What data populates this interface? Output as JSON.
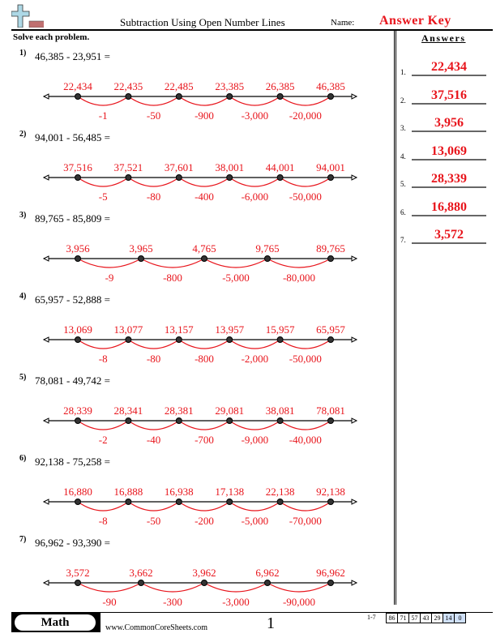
{
  "header": {
    "title": "Subtraction Using Open Number Lines",
    "name_label": "Name:",
    "name_value": "Answer Key",
    "instructions": "Solve each problem.",
    "answers_heading": "Answers"
  },
  "colors": {
    "accent_red": "#e8151c",
    "line_black": "#000000"
  },
  "problems": [
    {
      "num": "1)",
      "expr": "46,385 - 23,951 =",
      "points": [
        "22,434",
        "22,435",
        "22,485",
        "23,385",
        "26,385",
        "46,385"
      ],
      "jumps": [
        "-1",
        "-50",
        "-900",
        "-3,000",
        "-20,000"
      ]
    },
    {
      "num": "2)",
      "expr": "94,001 - 56,485 =",
      "points": [
        "37,516",
        "37,521",
        "37,601",
        "38,001",
        "44,001",
        "94,001"
      ],
      "jumps": [
        "-5",
        "-80",
        "-400",
        "-6,000",
        "-50,000"
      ]
    },
    {
      "num": "3)",
      "expr": "89,765 - 85,809 =",
      "points": [
        "3,956",
        "3,965",
        "4,765",
        "9,765",
        "89,765"
      ],
      "jumps": [
        "-9",
        "-800",
        "-5,000",
        "-80,000"
      ]
    },
    {
      "num": "4)",
      "expr": "65,957 - 52,888 =",
      "points": [
        "13,069",
        "13,077",
        "13,157",
        "13,957",
        "15,957",
        "65,957"
      ],
      "jumps": [
        "-8",
        "-80",
        "-800",
        "-2,000",
        "-50,000"
      ]
    },
    {
      "num": "5)",
      "expr": "78,081 - 49,742 =",
      "points": [
        "28,339",
        "28,341",
        "28,381",
        "29,081",
        "38,081",
        "78,081"
      ],
      "jumps": [
        "-2",
        "-40",
        "-700",
        "-9,000",
        "-40,000"
      ]
    },
    {
      "num": "6)",
      "expr": "92,138 - 75,258 =",
      "points": [
        "16,880",
        "16,888",
        "16,938",
        "17,138",
        "22,138",
        "92,138"
      ],
      "jumps": [
        "-8",
        "-50",
        "-200",
        "-5,000",
        "-70,000"
      ]
    },
    {
      "num": "7)",
      "expr": "96,962 - 93,390 =",
      "points": [
        "3,572",
        "3,662",
        "3,962",
        "6,962",
        "96,962"
      ],
      "jumps": [
        "-90",
        "-300",
        "-3,000",
        "-90,000"
      ]
    }
  ],
  "answers": [
    {
      "num": "1.",
      "value": "22,434"
    },
    {
      "num": "2.",
      "value": "37,516"
    },
    {
      "num": "3.",
      "value": "3,956"
    },
    {
      "num": "4.",
      "value": "13,069"
    },
    {
      "num": "5.",
      "value": "28,339"
    },
    {
      "num": "6.",
      "value": "16,880"
    },
    {
      "num": "7.",
      "value": "3,572"
    }
  ],
  "footer": {
    "subject": "Math",
    "site": "www.CommonCoreSheets.com",
    "page": "1",
    "score_label": "1-7",
    "scores": [
      "86",
      "71",
      "57",
      "43",
      "29",
      "14",
      "0"
    ]
  },
  "icons": {
    "logo": "plus-minus-logo-icon"
  }
}
